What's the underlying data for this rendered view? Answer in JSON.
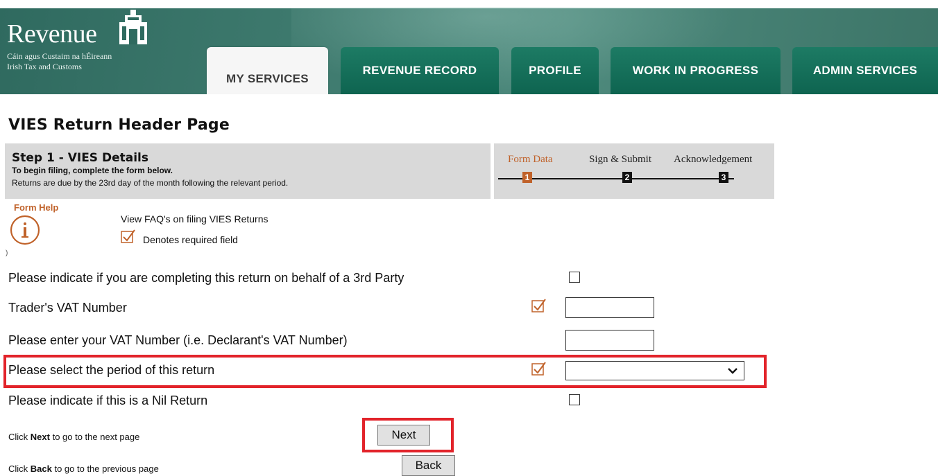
{
  "header": {
    "brand_name": "Revenue",
    "brand_irish": "Cáin agus Custaim na hÉireann",
    "brand_english": "Irish Tax and Customs",
    "tabs": [
      {
        "label": "MY SERVICES",
        "active": true
      },
      {
        "label": "REVENUE RECORD",
        "active": false
      },
      {
        "label": "PROFILE",
        "active": false
      },
      {
        "label": "WORK IN PROGRESS",
        "active": false
      },
      {
        "label": "ADMIN SERVICES",
        "active": false
      }
    ]
  },
  "page": {
    "title": "VIES Return Header Page",
    "step_title": "Step 1 - VIES Details",
    "step_subtitle": "To begin filing, complete the form below.",
    "step_note": "Returns are due by the 23rd day of the month following the relevant period."
  },
  "progress": {
    "steps": [
      {
        "label": "Form Data",
        "num": "1",
        "active": true
      },
      {
        "label": "Sign & Submit",
        "num": "2",
        "active": false
      },
      {
        "label": "Acknowledgement",
        "num": "3",
        "active": false
      }
    ]
  },
  "help": {
    "label": "Form Help",
    "faq_link": "View FAQ's on filing VIES Returns",
    "required_note": "Denotes required field",
    "stray_char": ")"
  },
  "form": {
    "third_party_label": "Please indicate if you are completing this return on behalf of a 3rd Party",
    "trader_vat_label": "Trader's VAT Number",
    "trader_vat_value": "",
    "declarant_vat_label": "Please enter your VAT Number (i.e. Declarant's VAT Number)",
    "declarant_vat_value": "",
    "period_label": "Please select the period of this return",
    "period_value": "",
    "nil_return_label": "Please indicate if this is a Nil Return"
  },
  "nav": {
    "next_prefix": "Click ",
    "next_bold": "Next",
    "next_suffix": " to go to the next page",
    "next_button": "Next",
    "back_prefix": "Click ",
    "back_bold": "Back",
    "back_suffix": " to go to the previous page",
    "back_button": "Back"
  },
  "colors": {
    "header_green": "#0e6450",
    "accent_orange": "#c0622a",
    "highlight_red": "#e2232a"
  }
}
